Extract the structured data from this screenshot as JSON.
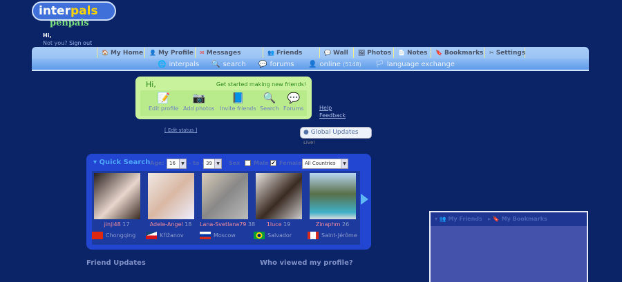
{
  "logo": {
    "text_a": "inter",
    "text_b": "pals",
    "sub": "penpals"
  },
  "user": {
    "greeting": "Hi,",
    "not_you": "Not you?",
    "sign_out": "Sign out"
  },
  "nav": {
    "tabs": [
      "My Home",
      "My Profile",
      "Messages",
      "Friends",
      "Wall",
      "Photos",
      "Notes",
      "Bookmarks",
      "Settings"
    ],
    "links": [
      "interpals",
      "search",
      "forums",
      "online",
      "(5148)",
      "language exchange"
    ]
  },
  "welcome": {
    "hi": "Hi,",
    "tagline": "Get started making new friends!",
    "actions": [
      "Edit profile",
      "Add photos",
      "Invite friends",
      "Search",
      "Forums"
    ]
  },
  "help": "Help",
  "feedback": "Feedback",
  "edit_status": "[ Edit status ]",
  "global_updates": {
    "label": "Global Updates",
    "badge": "Live!"
  },
  "quick_search": {
    "title": "Quick Search",
    "age_label": "Age:",
    "age_from": "16",
    "to_label": "- to -",
    "age_to": "39",
    "sex_label": "Sex",
    "male_label": "Male",
    "male_checked": false,
    "female_label": "Female",
    "female_checked": true,
    "country": "All Countries",
    "profiles": [
      {
        "name": "jinji48",
        "age": "17",
        "city": "Chongqing",
        "flag": "cn"
      },
      {
        "name": "Adele-Angel",
        "age": "18",
        "city": "Křižanov",
        "flag": "cz"
      },
      {
        "name": "Lana-Svetlana79",
        "age": "38",
        "city": "Moscow",
        "flag": "ru"
      },
      {
        "name": "1luce",
        "age": "19",
        "city": "Salvador",
        "flag": "br"
      },
      {
        "name": "Zinaphm",
        "age": "26",
        "city": "Saint-Jérôme",
        "flag": "ca"
      }
    ]
  },
  "sections": {
    "friend_updates": "Friend Updates",
    "who_viewed": "Who viewed my profile?"
  },
  "panel": {
    "my_friends": "My Friends",
    "my_bookmarks": "My Bookmarks"
  }
}
